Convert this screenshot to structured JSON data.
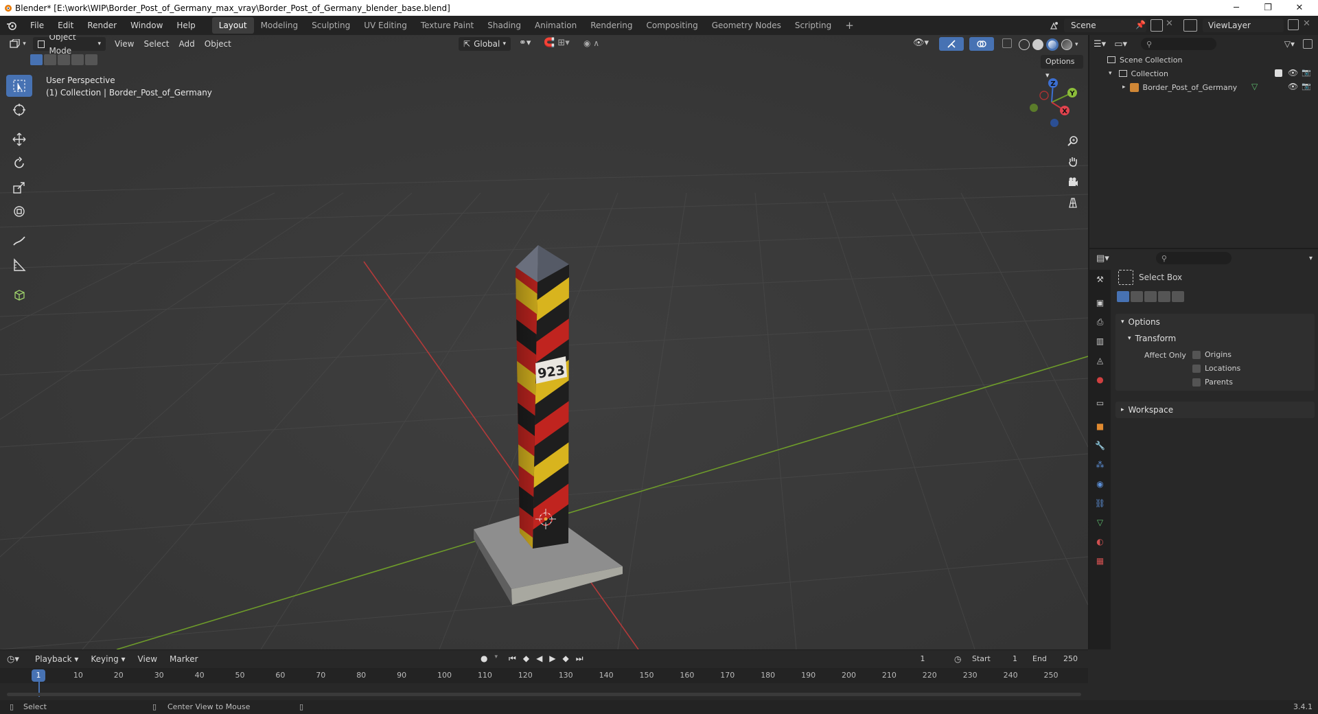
{
  "window": {
    "title": "Blender* [E:\\work\\WIP\\Border_Post_of_Germany_max_vray\\Border_Post_of_Germany_blender_base.blend]",
    "minimize": "─",
    "restore": "❐",
    "close": "✕"
  },
  "menu": {
    "file": "File",
    "edit": "Edit",
    "render": "Render",
    "window": "Window",
    "help": "Help"
  },
  "workspaces": [
    "Layout",
    "Modeling",
    "Sculpting",
    "UV Editing",
    "Texture Paint",
    "Shading",
    "Animation",
    "Rendering",
    "Compositing",
    "Geometry Nodes",
    "Scripting"
  ],
  "workspace_add": "+",
  "scene": {
    "label": "Scene",
    "view_layer": "ViewLayer"
  },
  "viewport": {
    "mode": "Object Mode",
    "menus": [
      "View",
      "Select",
      "Add",
      "Object"
    ],
    "orientation": "Global",
    "options": "Options",
    "overlay_title": "User Perspective",
    "overlay_subtitle": "(1) Collection | Border_Post_of_Germany",
    "post_number": "923",
    "gizmo": {
      "z": "Z",
      "y": "Y",
      "x": "X"
    }
  },
  "outliner": {
    "scene_collection": "Scene Collection",
    "collection": "Collection",
    "object": "Border_Post_of_Germany"
  },
  "properties": {
    "tool_name": "Select Box",
    "options_panel": "Options",
    "transform_panel": "Transform",
    "affect_only": "Affect Only",
    "origins": "Origins",
    "locations": "Locations",
    "parents": "Parents",
    "workspace_panel": "Workspace"
  },
  "timeline": {
    "menus": [
      "Playback",
      "Keying",
      "View",
      "Marker"
    ],
    "current_frame": "1",
    "start_label": "Start",
    "start_value": "1",
    "end_label": "End",
    "end_value": "250",
    "frame_marker": "1",
    "ticks": [
      "10",
      "20",
      "30",
      "40",
      "50",
      "60",
      "70",
      "80",
      "90",
      "100",
      "110",
      "120",
      "130",
      "140",
      "150",
      "160",
      "170",
      "180",
      "190",
      "200",
      "210",
      "220",
      "230",
      "240",
      "250"
    ]
  },
  "status": {
    "select": "Select",
    "center_view": "Center View to Mouse",
    "version": "3.4.1"
  },
  "colors": {
    "accent": "#4772b3",
    "x_axis": "#b33a3a",
    "y_axis": "#6e9c2a",
    "post_red": "#c0241f",
    "post_yellow": "#d8b41e",
    "post_black": "#1e1e1e"
  }
}
